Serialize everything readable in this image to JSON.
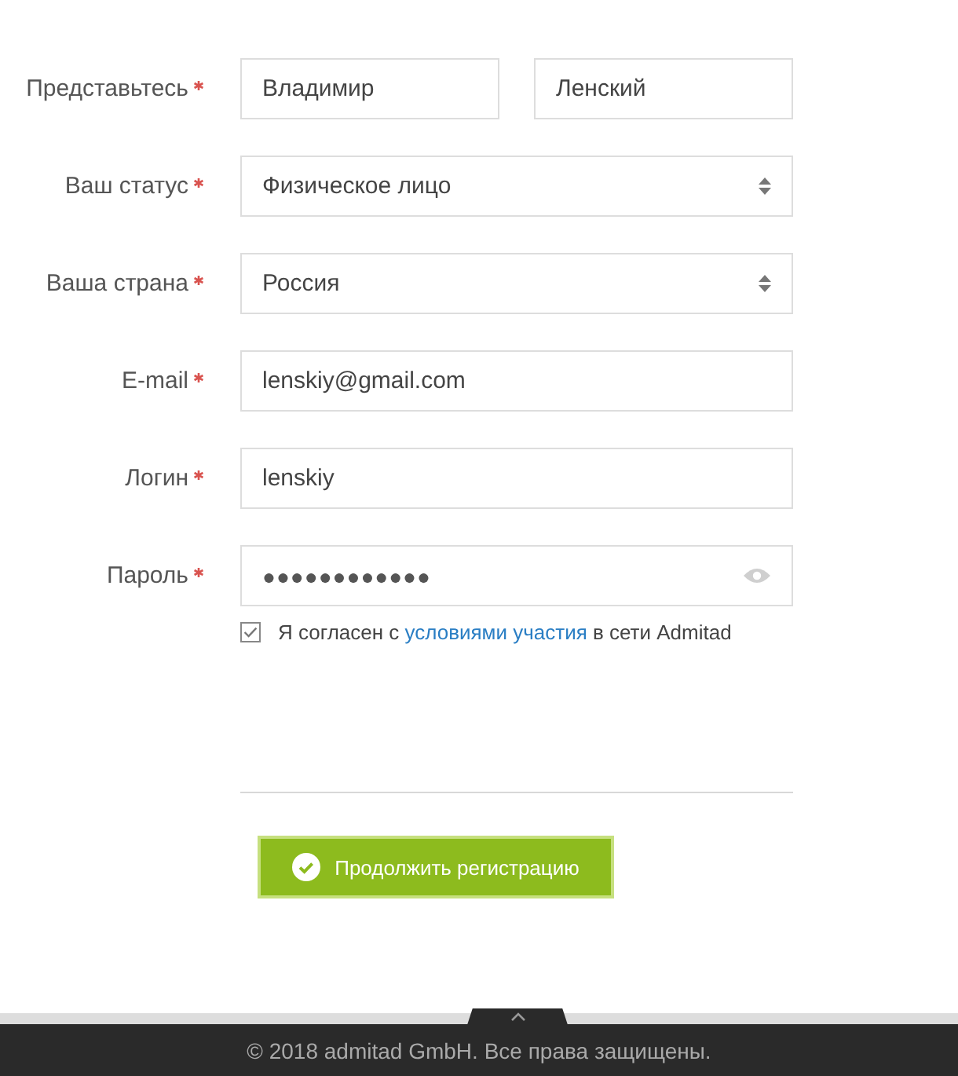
{
  "form": {
    "rows": [
      {
        "kind": "name_pair",
        "label": "Представьтесь",
        "required": true,
        "values": [
          "Владимир",
          "Ленский"
        ]
      },
      {
        "kind": "select",
        "label": "Ваш статус",
        "required": true,
        "value": "Физическое лицо"
      },
      {
        "kind": "select",
        "label": "Ваша страна",
        "required": true,
        "value": "Россия"
      },
      {
        "kind": "text",
        "label": "E-mail",
        "required": true,
        "value": "lenskiy@gmail.com"
      },
      {
        "kind": "text",
        "label": "Логин",
        "required": true,
        "value": "lenskiy"
      },
      {
        "kind": "password",
        "label": "Пароль",
        "required": true,
        "value": "●●●●●●●●●●●●"
      }
    ],
    "agreement": {
      "checked": true,
      "text_before": "Я согласен с ",
      "link": "условиями участия",
      "text_after": " в сети Admitad"
    },
    "submit": {
      "label": "Продолжить регистрацию"
    }
  },
  "footer": {
    "copyright": "© 2018 admitad GmbH. Все права защищены."
  }
}
